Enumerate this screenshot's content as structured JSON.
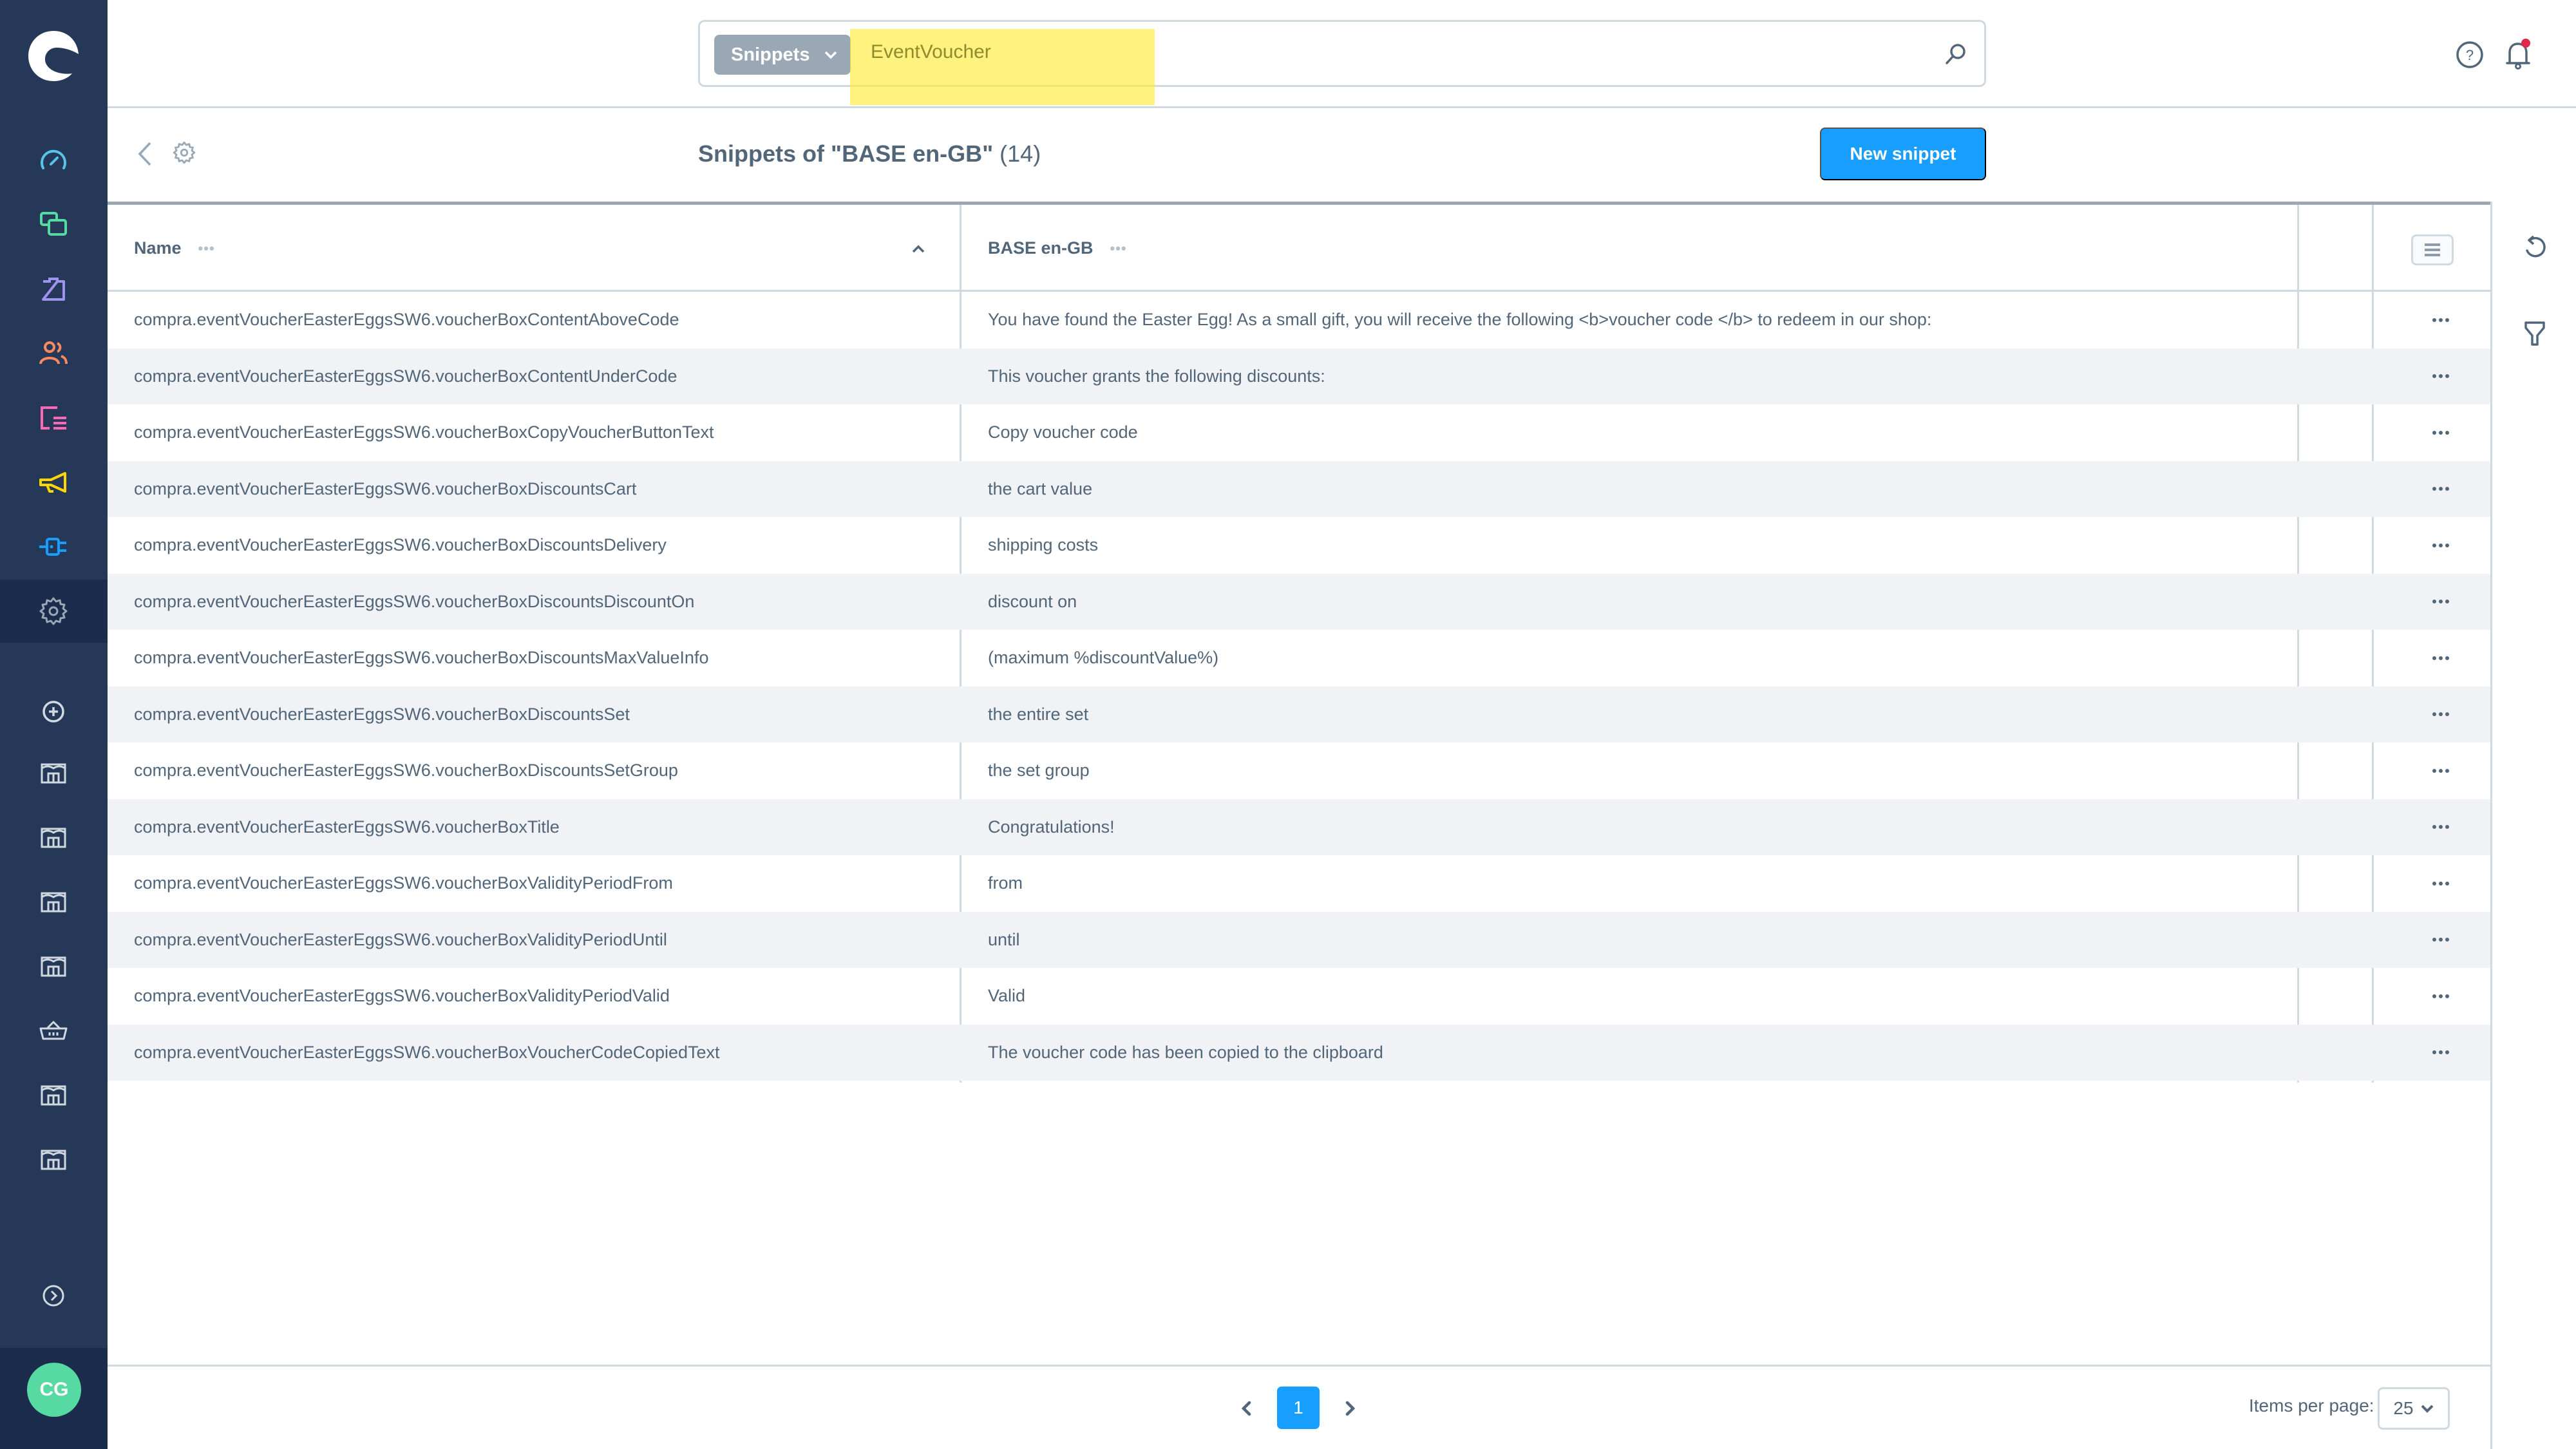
{
  "app": {
    "user_initials": "CG"
  },
  "sidebar": {
    "items": [
      {
        "name": "dashboard",
        "icon": "dashboard-gauge-icon",
        "color": "#57c3e8"
      },
      {
        "name": "catalogues",
        "icon": "catalogues-icon",
        "color": "#57d9a3"
      },
      {
        "name": "orders",
        "icon": "shopping-bag-icon",
        "color": "#a092f0"
      },
      {
        "name": "customers",
        "icon": "customers-icon",
        "color": "#f88962"
      },
      {
        "name": "content",
        "icon": "content-icon",
        "color": "#ff68b4"
      },
      {
        "name": "marketing",
        "icon": "megaphone-icon",
        "color": "#ffd700"
      },
      {
        "name": "extensions",
        "icon": "plug-icon",
        "color": "#189eff"
      },
      {
        "name": "settings",
        "icon": "gear-icon",
        "color": "#9aa8b5",
        "active": true
      }
    ],
    "sales_channels": [
      {
        "icon": "add-circle-icon"
      },
      {
        "icon": "storefront-icon"
      },
      {
        "icon": "storefront-icon"
      },
      {
        "icon": "storefront-icon"
      },
      {
        "icon": "storefront-icon"
      },
      {
        "icon": "basket-icon"
      },
      {
        "icon": "storefront-icon"
      },
      {
        "icon": "storefront-icon"
      }
    ],
    "expand_icon": "chevron-circle-right-icon"
  },
  "search": {
    "type_label": "Snippets",
    "value": "EventVoucher"
  },
  "header": {
    "title": "Snippets of \"BASE en-GB\"",
    "count": "(14)",
    "new_button": "New snippet"
  },
  "grid": {
    "columns": [
      {
        "label": "Name",
        "sorted": "asc"
      },
      {
        "label": "BASE en-GB"
      }
    ],
    "rows": [
      {
        "name": "compra.eventVoucherEasterEggsSW6.voucherBoxContentAboveCode",
        "value": "You have found the Easter Egg! As a small gift, you will receive the following <b>voucher code </b> to redeem in our shop:"
      },
      {
        "name": "compra.eventVoucherEasterEggsSW6.voucherBoxContentUnderCode",
        "value": "This voucher grants the following discounts:"
      },
      {
        "name": "compra.eventVoucherEasterEggsSW6.voucherBoxCopyVoucherButtonText",
        "value": "Copy voucher code"
      },
      {
        "name": "compra.eventVoucherEasterEggsSW6.voucherBoxDiscountsCart",
        "value": "the cart value"
      },
      {
        "name": "compra.eventVoucherEasterEggsSW6.voucherBoxDiscountsDelivery",
        "value": "shipping costs"
      },
      {
        "name": "compra.eventVoucherEasterEggsSW6.voucherBoxDiscountsDiscountOn",
        "value": "discount on"
      },
      {
        "name": "compra.eventVoucherEasterEggsSW6.voucherBoxDiscountsMaxValueInfo",
        "value": "(maximum %discountValue%)"
      },
      {
        "name": "compra.eventVoucherEasterEggsSW6.voucherBoxDiscountsSet",
        "value": "the entire set"
      },
      {
        "name": "compra.eventVoucherEasterEggsSW6.voucherBoxDiscountsSetGroup",
        "value": "the set group"
      },
      {
        "name": "compra.eventVoucherEasterEggsSW6.voucherBoxTitle",
        "value": "Congratulations!"
      },
      {
        "name": "compra.eventVoucherEasterEggsSW6.voucherBoxValidityPeriodFrom",
        "value": "from"
      },
      {
        "name": "compra.eventVoucherEasterEggsSW6.voucherBoxValidityPeriodUntil",
        "value": "until"
      },
      {
        "name": "compra.eventVoucherEasterEggsSW6.voucherBoxValidityPeriodValid",
        "value": "Valid"
      },
      {
        "name": "compra.eventVoucherEasterEggsSW6.voucherBoxVoucherCodeCopiedText",
        "value": "The voucher code has been copied to the clipboard"
      }
    ]
  },
  "pagination": {
    "current_page": "1",
    "items_per_page_label": "Items per page:",
    "items_per_page": "25"
  },
  "colors": {
    "sidebar_bg": "#253858",
    "primary": "#189eff",
    "highlight": "#ffeb3b",
    "notification": "#de294c"
  }
}
